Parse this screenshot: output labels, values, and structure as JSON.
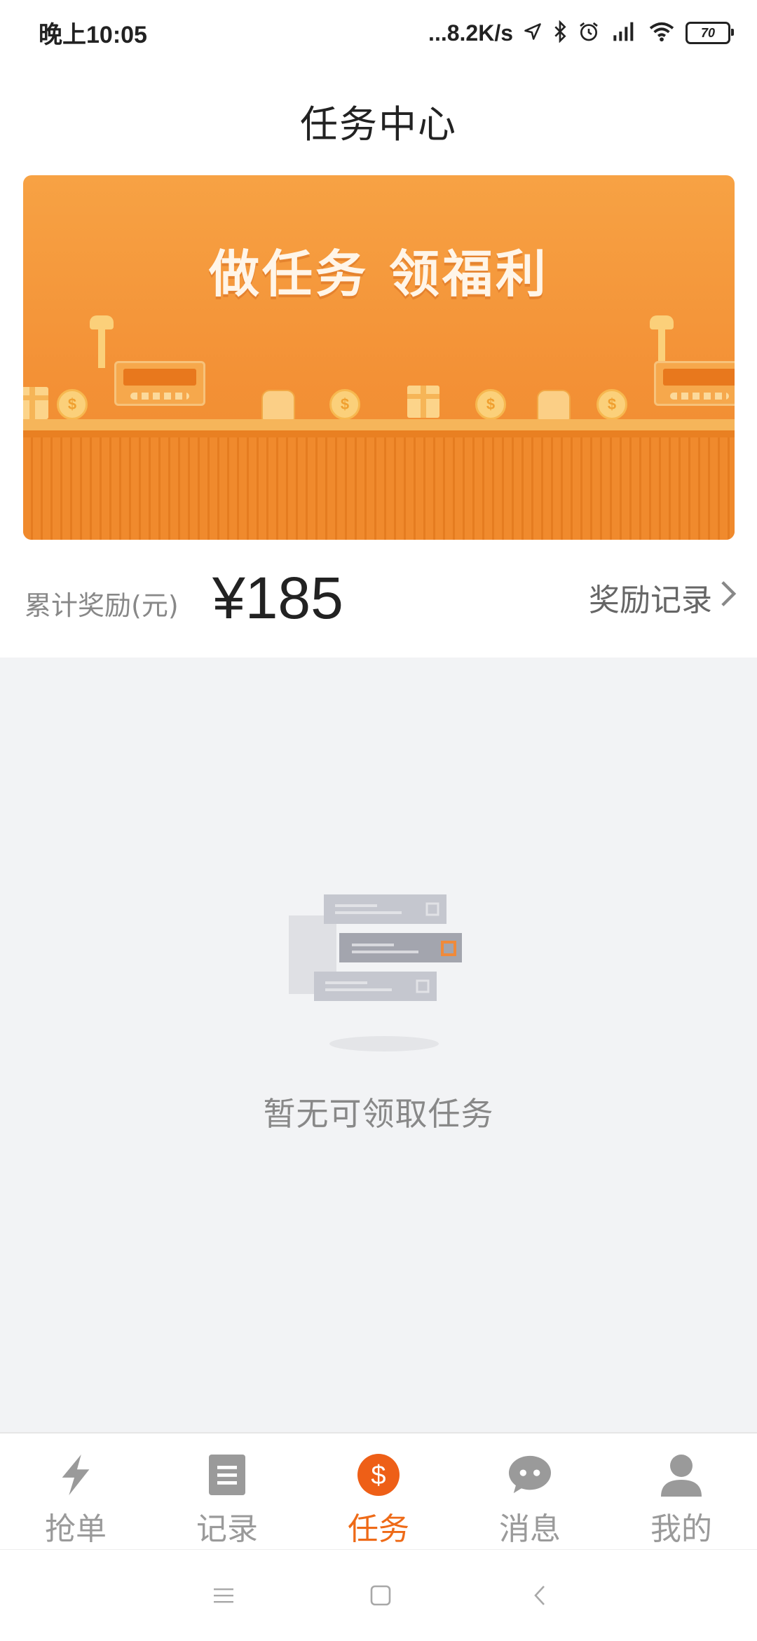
{
  "status_bar": {
    "time": "晚上10:05",
    "network_speed": "...8.2K/s",
    "battery": "70",
    "icons": [
      "location-icon",
      "bluetooth-icon",
      "alarm-icon",
      "signal-icon",
      "wifi-icon",
      "battery-icon"
    ]
  },
  "header": {
    "title": "任务中心"
  },
  "banner": {
    "title": "做任务  领福利",
    "accent_color": "#f39136"
  },
  "reward": {
    "label": "累计奖励(元)",
    "amount": "¥185",
    "link_label": "奖励记录"
  },
  "empty_state": {
    "message": "暂无可领取任务"
  },
  "bottom_nav": {
    "items": [
      {
        "label": "抢单",
        "icon": "lightning-icon",
        "active": false
      },
      {
        "label": "记录",
        "icon": "document-icon",
        "active": false
      },
      {
        "label": "任务",
        "icon": "dollar-icon",
        "active": true
      },
      {
        "label": "消息",
        "icon": "chat-icon",
        "active": false
      },
      {
        "label": "我的",
        "icon": "user-icon",
        "active": false
      }
    ],
    "active_color": "#ee6a17",
    "inactive_color": "#9a9a9a"
  },
  "system_nav": {
    "buttons": [
      "menu-icon",
      "home-icon",
      "back-icon"
    ]
  }
}
